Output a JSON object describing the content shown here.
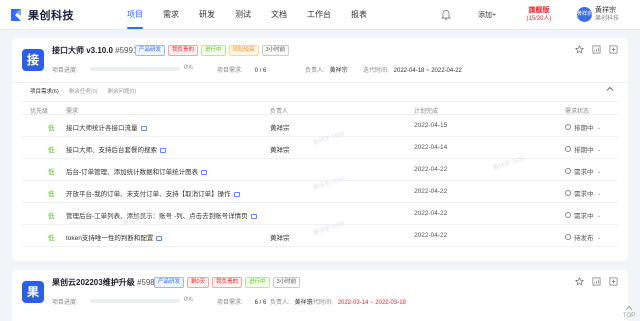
{
  "app": {
    "logo_text": "果创科技",
    "brand_color": "#2f6bff"
  },
  "nav": {
    "items": [
      {
        "label": "项目",
        "active": true
      },
      {
        "label": "需求",
        "active": false
      },
      {
        "label": "研发",
        "active": false
      },
      {
        "label": "测试",
        "active": false
      },
      {
        "label": "文档",
        "active": false
      },
      {
        "label": "工作台",
        "active": false
      },
      {
        "label": "报表",
        "active": false
      }
    ],
    "add_label": "添加+",
    "plan_name": "旗舰版",
    "plan_seats": "(15/20人)",
    "user_avatar_text": "黄祥宗",
    "user_name": "黄祥宗",
    "user_org": "果创科技"
  },
  "projects": [
    {
      "icon_char": "接",
      "name": "接口大师 v3.10.0",
      "id": "#59910",
      "tags": [
        {
          "label": "产品研发",
          "color": "blue"
        },
        {
          "label": "我负责的",
          "color": "red"
        },
        {
          "label": "进行中",
          "color": "green"
        },
        {
          "label": "风险较高",
          "color": "orange"
        },
        {
          "label": "3小时前",
          "color": "gray"
        }
      ],
      "progress_label": "项目进度:",
      "progress_fraction": 0.0,
      "progress_pct": "0%",
      "req_label": "项目需求:",
      "req_value": "0 / 6",
      "owner_label": "负责人:",
      "owner_value": "黄祥宗",
      "iter_label": "迭代时间:",
      "iter_value": "2022-04-18 ~ 2022-04-22",
      "subtabs": [
        "项目需求(6)",
        "剩余任务(0)",
        "剩余问题(0)"
      ],
      "columns": [
        "优先级",
        "需求",
        "负责人",
        "计划完成",
        "需求状态"
      ],
      "rows": [
        {
          "priority": "低",
          "title": "接口大师统计各接口流量",
          "owner": "黄祥宗",
          "due": "2022-04-15",
          "status": "排期中"
        },
        {
          "priority": "低",
          "title": "接口大师、支持后台套餐的搜索",
          "owner": "黄祥宗",
          "due": "2022-04-14",
          "status": "排期中"
        },
        {
          "priority": "低",
          "title": "后台-订单管理、添加统计数据和订单统计图表",
          "owner": "",
          "due": "2022-04-22",
          "status": "需求中"
        },
        {
          "priority": "低",
          "title": "开放平台-我的订单、未支付订单、支持【取消订单】操作",
          "owner": "",
          "due": "2022-04-22",
          "status": "需求中"
        },
        {
          "priority": "低",
          "title": "管理后台-工单列表、添加显示：账号 -列、点击去到账号详情页",
          "owner": "",
          "due": "2022-04-22",
          "status": "需求中"
        },
        {
          "priority": "低",
          "title": "token支持唯一性的判断和配置",
          "owner": "黄祥宗",
          "due": "2022-04-22",
          "status": "待发布"
        }
      ]
    },
    {
      "icon_char": "果",
      "name": "果创云202203维护升级",
      "id": "#59896",
      "tags": [
        {
          "label": "产品研发",
          "color": "blue"
        },
        {
          "label": "剩0天",
          "color": "red"
        },
        {
          "label": "我负责的",
          "color": "red"
        },
        {
          "label": "进行中",
          "color": "green"
        },
        {
          "label": "3小时前",
          "color": "gray"
        }
      ],
      "progress_label": "项目进度:",
      "progress_fraction": 0.0,
      "progress_pct": "0%",
      "req_label": "项目需求:",
      "req_value": "6 / 6",
      "owner_label": "负责人:",
      "owner_value": "黄祥宗",
      "iter_label": "迭代时间:",
      "iter_value": "2022-03-14 ~ 2022-03-18"
    }
  ],
  "watermark": "黄祥宗 0888",
  "top_label": "TOP"
}
